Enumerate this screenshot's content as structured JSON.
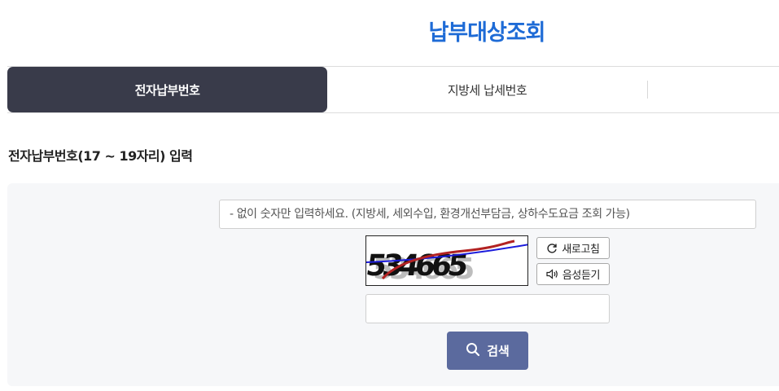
{
  "page": {
    "title": "납부대상조회"
  },
  "tabs": [
    {
      "label": "전자납부번호",
      "active": true
    },
    {
      "label": "지방세 납세번호",
      "active": false
    }
  ],
  "section": {
    "heading": "전자납부번호(17 ~ 19자리) 입력"
  },
  "form": {
    "number_input": {
      "placeholder": "- 없이 숫자만 입력하세요. (지방세, 세외수입, 환경개선부담금, 상하수도요금 조회 가능)",
      "value": ""
    },
    "captcha": {
      "text": "534665",
      "refresh_label": "새로고침",
      "audio_label": "음성듣기",
      "input_value": ""
    },
    "search_label": "검색"
  },
  "icons": {
    "refresh": "refresh-icon",
    "audio": "speaker-icon",
    "search": "search-icon"
  },
  "colors": {
    "title": "#1e6bd6",
    "active_tab": "#393b4a",
    "search_button": "#5b6a9e",
    "panel_bg": "#f6f7f9"
  }
}
